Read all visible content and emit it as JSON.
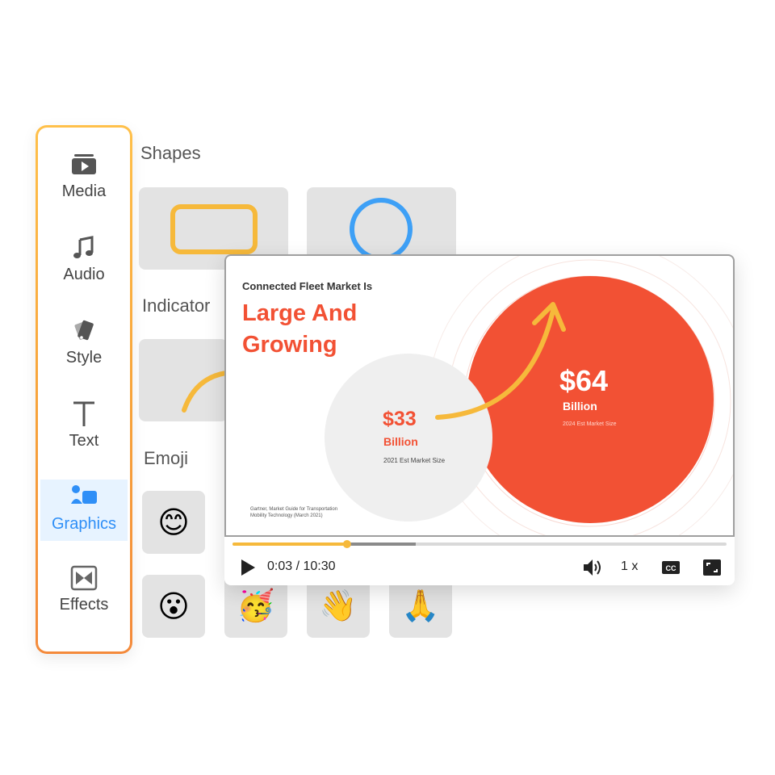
{
  "sidebar": {
    "items": [
      {
        "label": "Media",
        "icon": "media-icon"
      },
      {
        "label": "Audio",
        "icon": "music-note-icon"
      },
      {
        "label": "Style",
        "icon": "style-icon"
      },
      {
        "label": "Text",
        "icon": "text-icon"
      },
      {
        "label": "Graphics",
        "icon": "graphics-icon",
        "active": true
      },
      {
        "label": "Effects",
        "icon": "effects-icon"
      }
    ]
  },
  "panel": {
    "shapes_title": "Shapes",
    "indicator_title": "Indicator",
    "emoji_title": "Emoji",
    "emojis": [
      "😊",
      "😮",
      "🥳",
      "👋",
      "🙏"
    ]
  },
  "slide": {
    "subtitle": "Connected Fleet Market Is",
    "headline_line1": "Large And",
    "headline_line2": "Growing",
    "small_value": "$33",
    "small_unit": "Billion",
    "small_caption": "2021 Est Market Size",
    "big_value": "$64",
    "big_unit": "Billion",
    "big_caption": "2024 Est Market Size",
    "source": "Gartner, Market Guide for Transportation Mobility Technology (March 2021)",
    "colors": {
      "accent": "#f25134",
      "arrow": "#f6b93b",
      "grey_circle": "#efefef"
    }
  },
  "player": {
    "time": "0:03 / 10:30",
    "speed": "1 x",
    "progress": 0.23,
    "buffered": 0.37,
    "colors": {
      "played": "#f6b93b",
      "buffered": "#8a8a8a",
      "track": "#d9d9d9"
    }
  }
}
